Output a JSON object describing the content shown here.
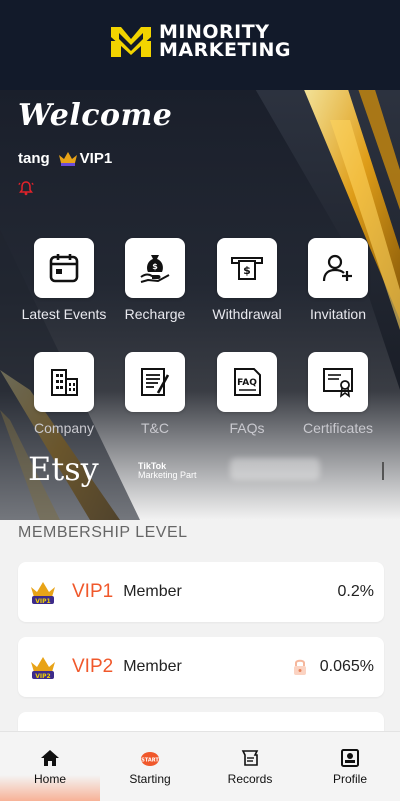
{
  "brand": {
    "line1": "MINORITY",
    "line2": "MARKETING",
    "accent": "#f2d400"
  },
  "hero": {
    "welcome": "Welcome",
    "username": "tang",
    "vip_level": "VIP1",
    "bell_icon": "bell-icon"
  },
  "actions": [
    {
      "label": "Latest Events",
      "icon": "calendar-icon"
    },
    {
      "label": "Recharge",
      "icon": "money-bag-hand-icon"
    },
    {
      "label": "Withdrawal",
      "icon": "cash-withdrawal-icon"
    },
    {
      "label": "Invitation",
      "icon": "add-user-icon"
    },
    {
      "label": "Company",
      "icon": "buildings-icon"
    },
    {
      "label": "T&C",
      "icon": "contract-pen-icon"
    },
    {
      "label": "FAQs",
      "icon": "faq-document-icon"
    },
    {
      "label": "Certificates",
      "icon": "certificate-icon"
    }
  ],
  "partners": {
    "etsy": "Etsy",
    "tiktok_line1": "TikTok",
    "tiktok_line2": "Marketing Part"
  },
  "membership": {
    "title": "MEMBERSHIP LEVEL",
    "levels": [
      {
        "name": "VIP1",
        "role": "Member",
        "rate": "0.2%",
        "locked": false
      },
      {
        "name": "VIP2",
        "role": "Member",
        "rate": "0.065%",
        "locked": true
      }
    ]
  },
  "nav": [
    {
      "label": "Home",
      "icon": "home-icon",
      "active": true
    },
    {
      "label": "Starting",
      "icon": "starting-icon",
      "active": false
    },
    {
      "label": "Records",
      "icon": "records-icon",
      "active": false
    },
    {
      "label": "Profile",
      "icon": "profile-icon",
      "active": false
    }
  ],
  "colors": {
    "vip_text": "#f0582b",
    "header_bg": "#121a2a",
    "gold": "#e8a317"
  }
}
